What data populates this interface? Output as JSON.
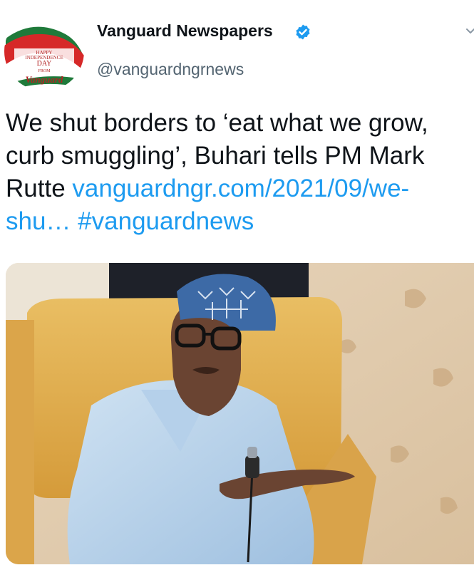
{
  "author": {
    "display_name": "Vanguard Newspapers",
    "handle": "@vanguardngrnews",
    "verified": true,
    "avatar_text": {
      "line1": "HAPPY",
      "line2": "INDEPENDENCE",
      "line3": "DAY",
      "line4": "FROM",
      "logo": "Vanguard"
    }
  },
  "tweet": {
    "text_part1": "We shut borders to ‘eat what we grow, curb smuggling’, Buhari tells PM Mark Rutte ",
    "link": "vanguardngr.com/2021/09/we-shu…",
    "hashtag": "#vanguardnews"
  },
  "media": {
    "icon": "photo"
  },
  "colors": {
    "accent": "#1d9bf0",
    "text": "#0f1419",
    "secondary": "#536471"
  },
  "icons": {
    "verified": "verified-badge-icon",
    "more": "chevron-down-icon"
  }
}
